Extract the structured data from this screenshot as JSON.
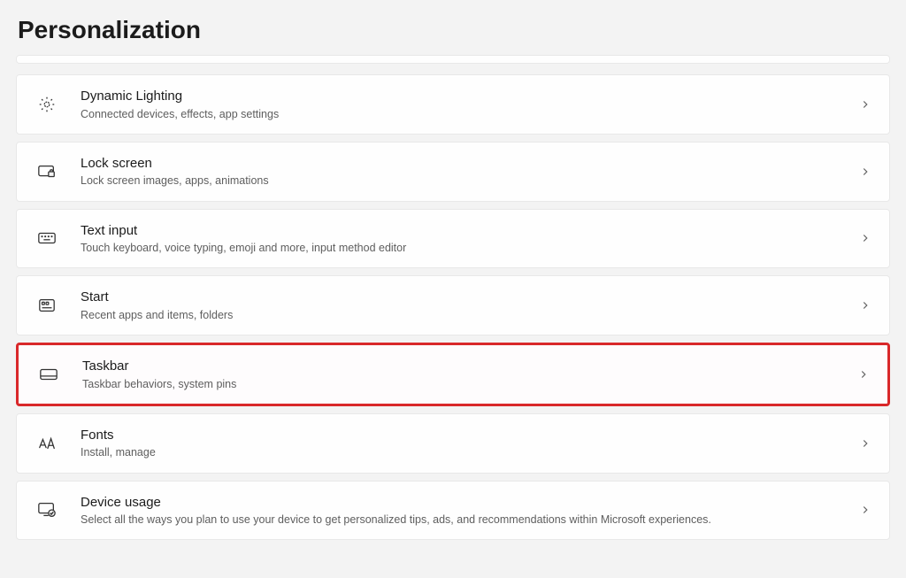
{
  "page": {
    "title": "Personalization"
  },
  "items": [
    {
      "title": "Dynamic Lighting",
      "desc": "Connected devices, effects, app settings"
    },
    {
      "title": "Lock screen",
      "desc": "Lock screen images, apps, animations"
    },
    {
      "title": "Text input",
      "desc": "Touch keyboard, voice typing, emoji and more, input method editor"
    },
    {
      "title": "Start",
      "desc": "Recent apps and items, folders"
    },
    {
      "title": "Taskbar",
      "desc": "Taskbar behaviors, system pins"
    },
    {
      "title": "Fonts",
      "desc": "Install, manage"
    },
    {
      "title": "Device usage",
      "desc": "Select all the ways you plan to use your device to get personalized tips, ads, and recommendations within Microsoft experiences."
    }
  ]
}
